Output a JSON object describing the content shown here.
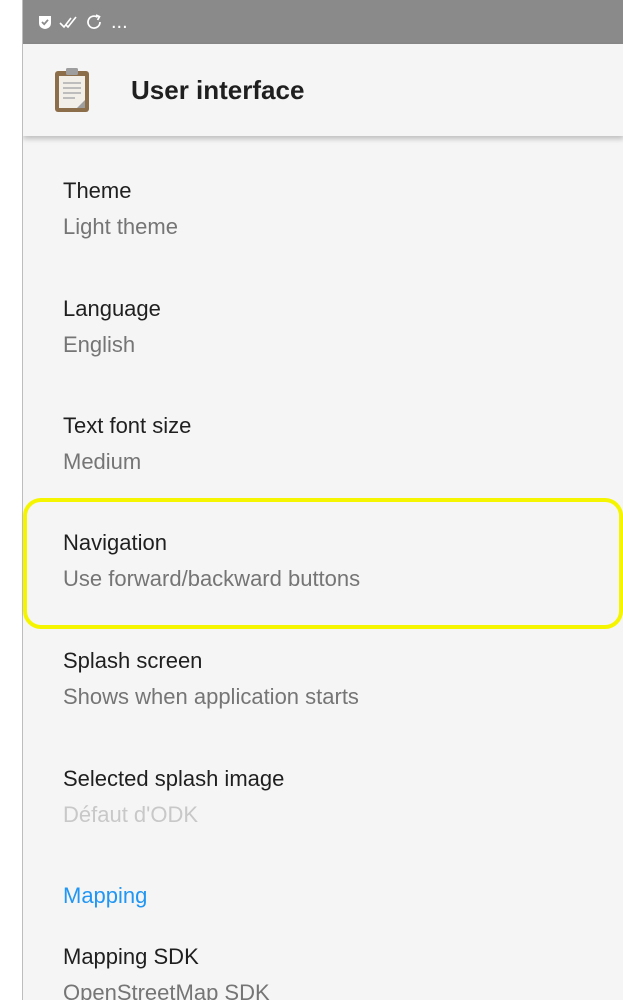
{
  "status_bar": {
    "icons": [
      "shield-check-icon",
      "double-check-icon",
      "sync-icon"
    ],
    "more": "..."
  },
  "app_bar": {
    "icon": "clipboard-icon",
    "title": "User interface"
  },
  "preferences": [
    {
      "title": "Theme",
      "summary": "Light theme"
    },
    {
      "title": "Language",
      "summary": "English"
    },
    {
      "title": "Text font size",
      "summary": "Medium"
    },
    {
      "title": "Navigation",
      "summary": "Use forward/backward buttons",
      "highlighted": true
    },
    {
      "title": "Splash screen",
      "summary": "Shows when application starts"
    },
    {
      "title": "Selected splash image",
      "summary": "Défaut d'ODK",
      "summary_disabled": true
    }
  ],
  "category": {
    "label": "Mapping"
  },
  "mapping_pref": {
    "title": "Mapping SDK",
    "summary": "OpenStreetMap SDK"
  },
  "colors": {
    "status_bar": "#8a8a8a",
    "background": "#f5f5f5",
    "accent": "#2196f3",
    "highlight": "#f5f500"
  }
}
